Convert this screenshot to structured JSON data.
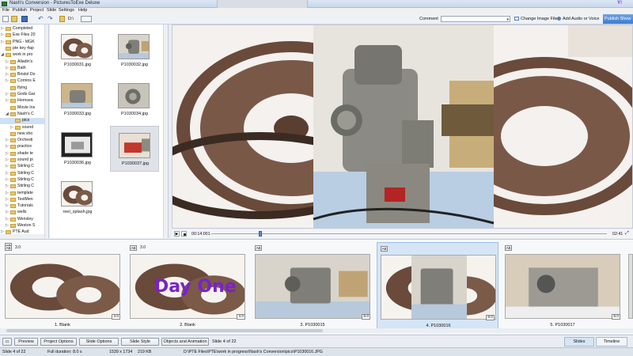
{
  "title_bar": {
    "title": "Nash's Conversion - PicturesToExe Deluxe"
  },
  "menu": [
    "File",
    "Publish",
    "Project",
    "Slide",
    "Settings",
    "Help"
  ],
  "toolbar": {
    "path_label": "D:\\",
    "comment_label": "Comment",
    "change_image_label": "Change Image File",
    "add_audio_label": "Add Audio or Voice",
    "publish_label": "Publish Show"
  },
  "folder_tree": [
    {
      "label": "Completed",
      "indent": 1,
      "arrow": "▷"
    },
    {
      "label": "Exe Files 20",
      "indent": 1,
      "arrow": "▷"
    },
    {
      "label": "PNG - MGK",
      "indent": 1,
      "arrow": "▷"
    },
    {
      "label": "pte key 4ap",
      "indent": 1,
      "arrow": ""
    },
    {
      "label": "work in pro",
      "indent": 1,
      "arrow": "◢"
    },
    {
      "label": "Alladin's",
      "indent": 2,
      "arrow": "▷"
    },
    {
      "label": "Bath",
      "indent": 2,
      "arrow": "▷"
    },
    {
      "label": "Bristol Do",
      "indent": 2,
      "arrow": "▷"
    },
    {
      "label": "Cornins E",
      "indent": 2,
      "arrow": "▷"
    },
    {
      "label": "flying",
      "indent": 2,
      "arrow": ""
    },
    {
      "label": "Gods Gar",
      "indent": 2,
      "arrow": "▷"
    },
    {
      "label": "Hornsea",
      "indent": 2,
      "arrow": "▷"
    },
    {
      "label": "Movie Ins",
      "indent": 2,
      "arrow": ""
    },
    {
      "label": "Nash's C",
      "indent": 2,
      "arrow": "◢"
    },
    {
      "label": "pics",
      "indent": 3,
      "arrow": "",
      "selected": true
    },
    {
      "label": "sound",
      "indent": 3,
      "arrow": "▷"
    },
    {
      "label": "new sho",
      "indent": 2,
      "arrow": ""
    },
    {
      "label": "Orchesti",
      "indent": 2,
      "arrow": "▷"
    },
    {
      "label": "practice",
      "indent": 2,
      "arrow": "▷"
    },
    {
      "label": "shade te",
      "indent": 2,
      "arrow": "▷"
    },
    {
      "label": "sound pi",
      "indent": 2,
      "arrow": "▷"
    },
    {
      "label": "Stirling C",
      "indent": 2,
      "arrow": "▷"
    },
    {
      "label": "Stirling C",
      "indent": 2,
      "arrow": "▷"
    },
    {
      "label": "Stirling C",
      "indent": 2,
      "arrow": "▷"
    },
    {
      "label": "Stirling C",
      "indent": 2,
      "arrow": "▷"
    },
    {
      "label": "template",
      "indent": 2,
      "arrow": "▷"
    },
    {
      "label": "TestMen",
      "indent": 2,
      "arrow": "▷"
    },
    {
      "label": "Tutorials",
      "indent": 2,
      "arrow": "▷"
    },
    {
      "label": "wells",
      "indent": 2,
      "arrow": "▷"
    },
    {
      "label": "Wensley",
      "indent": 2,
      "arrow": "▷"
    },
    {
      "label": "Weston S",
      "indent": 2,
      "arrow": "▷"
    },
    {
      "label": "PTE Aud",
      "indent": 1,
      "arrow": "▷"
    }
  ],
  "files": [
    {
      "name": "P1030031.jpg",
      "thumb": "reels"
    },
    {
      "name": "P1030032.jpg",
      "thumb": "projector"
    },
    {
      "name": "P1030033.jpg",
      "thumb": "projector-side"
    },
    {
      "name": "P1030034.jpg",
      "thumb": "lens"
    },
    {
      "name": "P1030036.jpg",
      "thumb": "screen"
    },
    {
      "name": "P1030037.jpg",
      "thumb": "box",
      "selected": true
    },
    {
      "name": "reel_splash.jpg",
      "thumb": "reels"
    }
  ],
  "transport": {
    "time_current": "00:14.001",
    "time_total": "02:41",
    "position_fraction": 0.12
  },
  "slides": [
    {
      "label": "1. Blank",
      "duration": "3.0",
      "badge": "3.0",
      "thumb": "reels",
      "overlay": ""
    },
    {
      "label": "2. Blank",
      "duration": "3.0",
      "badge": "3.0",
      "thumb": "reels",
      "overlay": "Day One"
    },
    {
      "label": "3. P1030015",
      "duration": "",
      "badge": "8.0",
      "thumb": "projector",
      "overlay": ""
    },
    {
      "label": "4. P1030016",
      "duration": "",
      "badge": "8.0",
      "thumb": "combo",
      "overlay": "",
      "selected": true
    },
    {
      "label": "5. P1030017",
      "duration": "",
      "badge": "8.0",
      "thumb": "open",
      "overlay": ""
    }
  ],
  "ab_label": "AB",
  "bottom_buttons": {
    "preview": "Preview",
    "project_options": "Project Options",
    "slide_options": "Slide Options",
    "slide_style": "Slide Style",
    "objects_animation": "Objects and Animation",
    "slide_info": "Slide 4 of 22"
  },
  "view_tabs": {
    "slides": "Slides",
    "timeline": "Timeline",
    "active": "slides"
  },
  "status": {
    "slide": "Slide 4 of 22",
    "duration": "Full duration: 8.0 s",
    "dimensions": "1539 x 1734",
    "size": "219 KB",
    "path": "D:\\PTE Files\\PTE\\work in progress\\Nash's Conversion\\pics\\P1030016.JPG"
  },
  "colors": {
    "accent": "#3f7ad0",
    "selection": "#d6e5f6",
    "folder": "#e8c766",
    "overlay_text": "#7a22c7"
  }
}
